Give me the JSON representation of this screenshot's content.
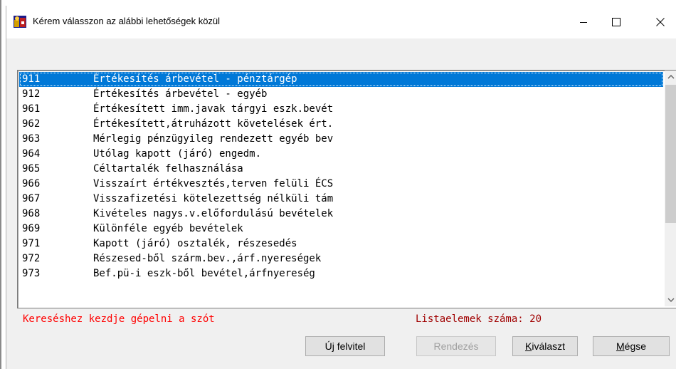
{
  "window": {
    "title": "Kérem válasszon az alábbi lehetőségek közül",
    "icon": "app-icon"
  },
  "list": {
    "items": [
      {
        "code": "911",
        "label": "Értékesítés árbevétel - pénztárgép",
        "selected": true
      },
      {
        "code": "912",
        "label": "Értékesítés árbevétel - egyéb"
      },
      {
        "code": "961",
        "label": "Értékesített imm.javak tárgyi eszk.bevét"
      },
      {
        "code": "962",
        "label": "Értékesített,átruházott követelések ért."
      },
      {
        "code": "963",
        "label": "Mérlegig pénzügyileg rendezett egyéb bev"
      },
      {
        "code": "964",
        "label": "Utólag kapott (járó) engedm."
      },
      {
        "code": "965",
        "label": "Céltartalék felhasználása"
      },
      {
        "code": "966",
        "label": "Visszaírt értékvesztés,terven felüli ÉCS"
      },
      {
        "code": "967",
        "label": "Visszafizetési kötelezettség nélküli tám"
      },
      {
        "code": "968",
        "label": "Kivételes nagys.v.előfordulású bevételek"
      },
      {
        "code": "969",
        "label": "Különféle egyéb bevételek"
      },
      {
        "code": "971",
        "label": "Kapott (járó) osztalék, részesedés"
      },
      {
        "code": "972",
        "label": "Részesed-ből szárm.bev.,árf.nyereségek"
      },
      {
        "code": "973",
        "label": "Bef.pü-i eszk-ből bevétel,árfnyereség"
      }
    ]
  },
  "status": {
    "hint": "Kereséshez kezdje gépelni a szót",
    "count_text": "Listaelemek száma: 20"
  },
  "buttons": {
    "new": "Új felvitel",
    "sort": "Rendezés",
    "select_prefix": "",
    "select_ul": "K",
    "select_rest": "iválaszt",
    "cancel_ul": "M",
    "cancel_rest": "égse"
  },
  "colors": {
    "selection": "#0078d7",
    "hint": "#ff0000",
    "count": "#a00000"
  }
}
